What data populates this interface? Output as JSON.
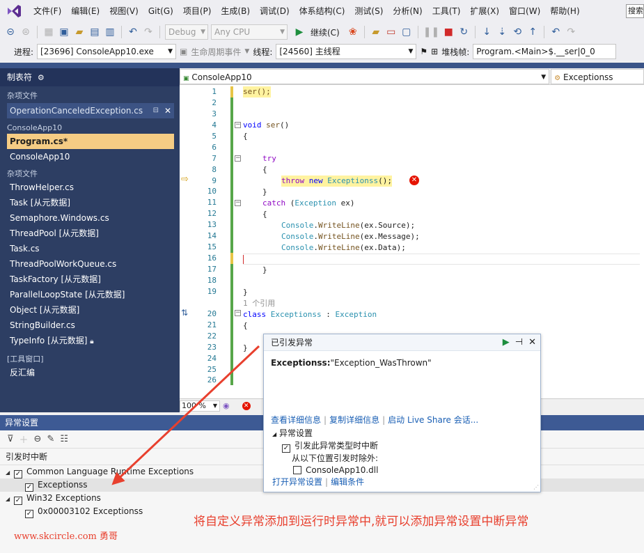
{
  "menubar": {
    "items": [
      "文件(F)",
      "编辑(E)",
      "视图(V)",
      "Git(G)",
      "项目(P)",
      "生成(B)",
      "调试(D)",
      "体系结构(C)",
      "测试(S)",
      "分析(N)",
      "工具(T)",
      "扩展(X)",
      "窗口(W)",
      "帮助(H)"
    ],
    "search": "搜索"
  },
  "toolbar1": {
    "config": "Debug",
    "platform": "Any CPU",
    "run_label": "继续(C)"
  },
  "toolbar2": {
    "process_label": "进程:",
    "process_value": "[23696] ConsoleApp10.exe",
    "lifecycle_label": "生命周期事件",
    "thread_label": "线程:",
    "thread_value": "[24560] 主线程",
    "stack_label": "堆栈帧:",
    "stack_value": "Program.<Main>$.__ser|0_0"
  },
  "left_panel": {
    "title": "制表符",
    "group_misc": "杂项文件",
    "open_tab": "OperationCanceledException.cs",
    "project": "ConsoleApp10",
    "selected_file": "Program.cs*",
    "project_file": "ConsoleApp10",
    "group_misc2": "杂项文件",
    "files": [
      "ThrowHelper.cs",
      "Task [从元数据]",
      "Semaphore.Windows.cs",
      "ThreadPool [从元数据]",
      "Task.cs",
      "ThreadPoolWorkQueue.cs",
      "TaskFactory [从元数据]",
      "ParallelLoopState [从元数据]",
      "Object [从元数据]",
      "StringBuilder.cs",
      "TypeInfo [从元数据]"
    ],
    "group_tools": "[工具窗口]",
    "tool_item": "反汇编"
  },
  "editor": {
    "nav_left": "ConsoleApp10",
    "nav_right": "Exceptionss",
    "line_numbers": [
      "1",
      "2",
      "3",
      "4",
      "5",
      "6",
      "7",
      "8",
      "9",
      "10",
      "11",
      "12",
      "13",
      "14",
      "15",
      "16",
      "17",
      "18",
      "19",
      "20",
      "21",
      "22",
      "23",
      "24",
      "25",
      "26"
    ],
    "code": {
      "l1": "ser();",
      "l4a": "void",
      "l4b": "ser",
      "l4c": "()",
      "l5": "{",
      "l7": "try",
      "l8": "{",
      "l9a": "throw",
      "l9b": "new",
      "l9c": "Exceptionss",
      "l9d": "();",
      "l10": "}",
      "l11a": "catch",
      "l11b": " (",
      "l11c": "Exception",
      "l11d": " ex)",
      "l12": "{",
      "l13a": "Console",
      "l13b": ".",
      "l13c": "WriteLine",
      "l13d": "(ex.Source);",
      "l14d": "(ex.Message);",
      "l15d": "(ex.Data);",
      "l17": "}",
      "l19": "}",
      "refs": "1 个引用",
      "l20a": "class",
      "l20b": "Exceptionss",
      "l20c": " : ",
      "l20d": "Exception",
      "l21": "{",
      "l23": "}"
    },
    "zoom": "100 %"
  },
  "popup": {
    "title": "已引发异常",
    "exception_type": "Exceptionss:",
    "exception_msg": "\"Exception_WasThrown\"",
    "link_details": "查看详细信息",
    "link_copy": "复制详细信息",
    "link_liveshare": "启动 Live Share 会话...",
    "section": "异常设置",
    "break_when": "引发此异常类型时中断",
    "except_from": "从以下位置引发时除外:",
    "dll": "ConsoleApp10.dll",
    "open_settings": "打开异常设置",
    "edit_conditions": "编辑条件"
  },
  "exception_settings": {
    "title": "异常设置",
    "subheader": "引发时中断",
    "tree": [
      {
        "label": "Common Language Runtime Exceptions"
      },
      {
        "label": "Exceptionss"
      },
      {
        "label": "Win32 Exceptions"
      },
      {
        "label": "0x00003102 Exceptionss"
      }
    ]
  },
  "annotation": "将自定义异常添加到运行时异常中,就可以添加异常设置中断异常",
  "watermark": "www.skcircle.com 勇哥",
  "colors": {
    "accent": "#3d5a94",
    "annotation_red": "#e8402e",
    "selection_yellow": "#f5cc84",
    "sidebar_bg": "#2d3e63"
  }
}
